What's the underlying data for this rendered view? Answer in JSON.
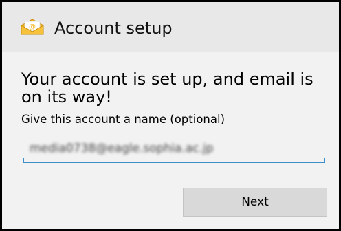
{
  "header": {
    "title": "Account setup",
    "icon": "email-app-icon",
    "icon_color": "#f4b822"
  },
  "main": {
    "headline": "Your account is set up, and email is on its way!",
    "name_label": "Give this account a name (optional)",
    "name_value": "media0738@eagle.sophia.ac.jp",
    "next_label": "Next"
  },
  "colors": {
    "accent": "#3d8fc9",
    "button_bg": "#d9d9d9",
    "background": "#f2f2f2"
  }
}
